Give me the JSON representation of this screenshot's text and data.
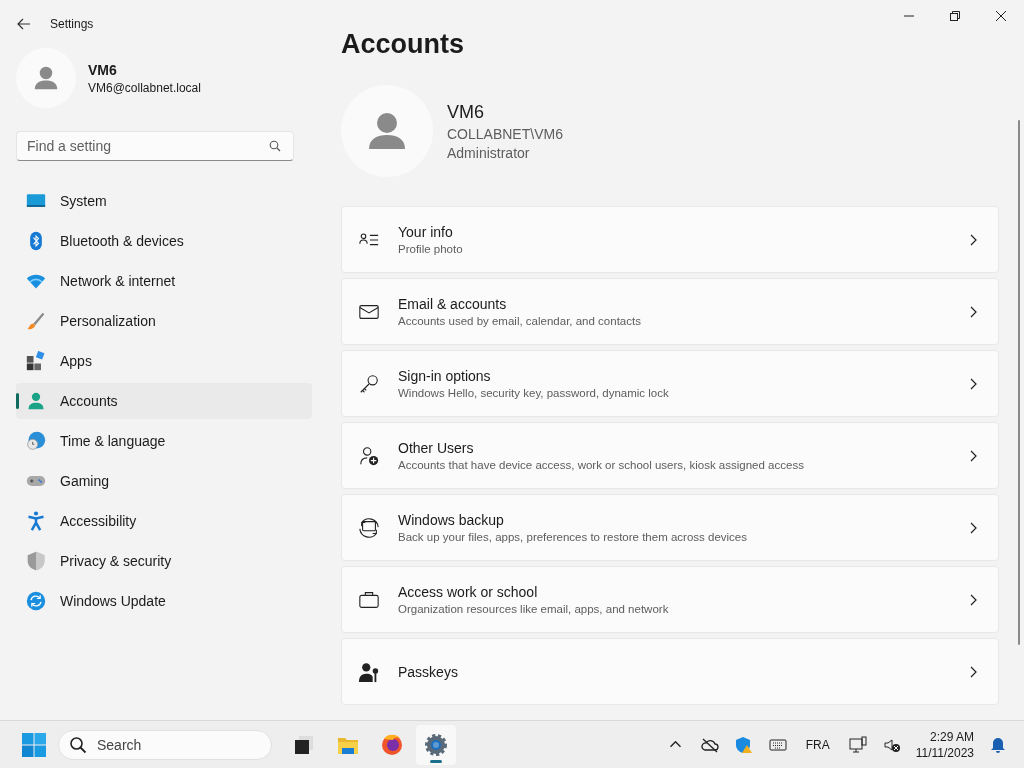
{
  "window": {
    "title": "Settings"
  },
  "user": {
    "name": "VM6",
    "email": "VM6@collabnet.local"
  },
  "search": {
    "placeholder": "Find a setting"
  },
  "nav": [
    {
      "label": "System",
      "selected": false
    },
    {
      "label": "Bluetooth & devices",
      "selected": false
    },
    {
      "label": "Network & internet",
      "selected": false
    },
    {
      "label": "Personalization",
      "selected": false
    },
    {
      "label": "Apps",
      "selected": false
    },
    {
      "label": "Accounts",
      "selected": true
    },
    {
      "label": "Time & language",
      "selected": false
    },
    {
      "label": "Gaming",
      "selected": false
    },
    {
      "label": "Accessibility",
      "selected": false
    },
    {
      "label": "Privacy & security",
      "selected": false
    },
    {
      "label": "Windows Update",
      "selected": false
    }
  ],
  "page_title": "Accounts",
  "account": {
    "name": "VM6",
    "domain": "COLLABNET\\VM6",
    "role": "Administrator"
  },
  "cards": [
    {
      "title": "Your info",
      "subtitle": "Profile photo"
    },
    {
      "title": "Email & accounts",
      "subtitle": "Accounts used by email, calendar, and contacts"
    },
    {
      "title": "Sign-in options",
      "subtitle": "Windows Hello, security key, password, dynamic lock"
    },
    {
      "title": "Other Users",
      "subtitle": "Accounts that have device access, work or school users, kiosk assigned access"
    },
    {
      "title": "Windows backup",
      "subtitle": "Back up your files, apps, preferences to restore them across devices"
    },
    {
      "title": "Access work or school",
      "subtitle": "Organization resources like email, apps, and network"
    },
    {
      "title": "Passkeys"
    }
  ],
  "taskbar": {
    "search_placeholder": "Search",
    "apps": [
      {
        "selected": false
      },
      {
        "selected": false
      },
      {
        "selected": false
      },
      {
        "selected": true
      }
    ],
    "language": "FRA",
    "time": "2:29 AM",
    "date": "11/11/2023"
  }
}
